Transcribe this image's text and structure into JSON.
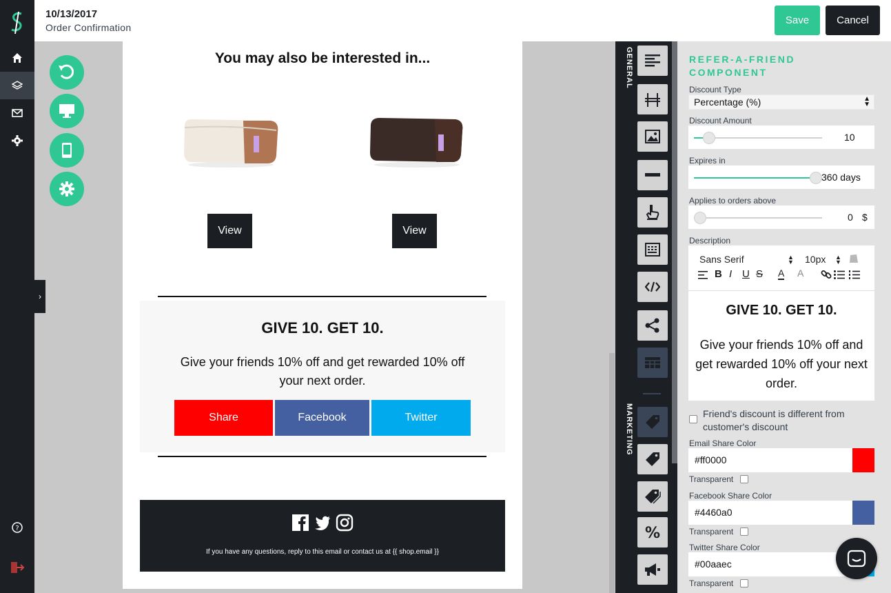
{
  "header": {
    "date": "10/13/2017",
    "subtitle": "Order Confirmation",
    "save_label": "Save",
    "cancel_label": "Cancel"
  },
  "nav": {
    "icons": [
      "home-icon",
      "layers-icon",
      "mail-icon",
      "gear-icon",
      "help-icon",
      "logout-icon"
    ]
  },
  "tools": {
    "round": [
      "undo-icon",
      "desktop-icon",
      "mobile-icon",
      "settings-icon"
    ]
  },
  "email": {
    "interest_title": "You may also be interested in...",
    "products": [
      {
        "view_label": "View"
      },
      {
        "view_label": "View"
      }
    ],
    "raf_title": "GIVE 10. GET 10.",
    "raf_text": "Give your friends 10% off and get rewarded 10% off your next order.",
    "share_buttons": [
      {
        "label": "Share",
        "color": "#ff0000"
      },
      {
        "label": "Facebook",
        "color": "#4460a0"
      },
      {
        "label": "Twitter",
        "color": "#00aaec"
      }
    ],
    "footer_text": "If you have any questions, reply to this email or contact us at {{ shop.email }}"
  },
  "tabs": {
    "general_label": "GENERAL",
    "marketing_label": "MARKETING"
  },
  "panel": {
    "title": "REFER-A-FRIEND COMPONENT",
    "discount_type_label": "Discount Type",
    "discount_type_value": "Percentage (%)",
    "discount_amount_label": "Discount Amount",
    "discount_amount_value": "10",
    "discount_amount_level": 0.08,
    "expires_label": "Expires in",
    "expires_value": "360 days",
    "expires_level": 1.0,
    "applies_label": "Applies to orders above",
    "applies_value": "0",
    "applies_unit": "$",
    "applies_level": 0.0,
    "description_label": "Description",
    "font_value": "Sans Serif",
    "size_value": "10px",
    "preview_title": "GIVE 10. GET 10.",
    "preview_text": "Give your friends 10% off and get rewarded 10% off your next order.",
    "friend_checkbox_label": "Friend's discount is different from customer's discount",
    "email_color_label": "Email Share Color",
    "email_color": "#ff0000",
    "facebook_color_label": "Facebook Share Color",
    "facebook_color": "#4460a0",
    "twitter_color_label": "Twitter Share Color",
    "twitter_color": "#00aaec",
    "transparent_label": "Transparent"
  }
}
